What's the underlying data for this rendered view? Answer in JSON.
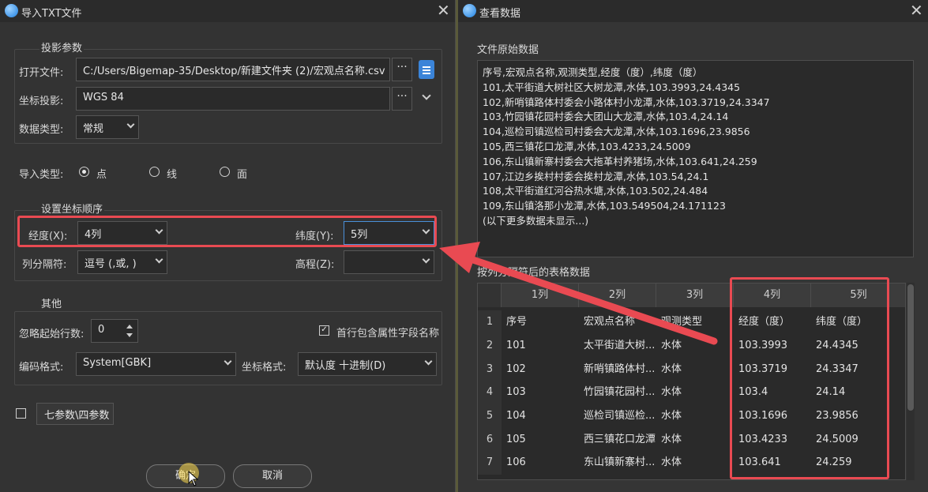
{
  "left": {
    "title": "导入TXT文件",
    "projection": {
      "group_label": "投影参数",
      "open_file_label": "打开文件:",
      "file_path": "C:/Users/Bigemap-35/Desktop/新建文件夹 (2)/宏观点名称.csv",
      "browse": "···",
      "crs_label": "坐标投影:",
      "crs_value": "WGS 84",
      "crs_browse": "···",
      "data_type_label": "数据类型:",
      "data_type_value": "常规"
    },
    "import_type": {
      "label": "导入类型:",
      "options": [
        "点",
        "线",
        "面"
      ],
      "selected": "点"
    },
    "coord_order": {
      "group_label": "设置坐标顺序",
      "lon_label": "经度(X):",
      "lon_value": "4列",
      "lat_label": "纬度(Y):",
      "lat_value": "5列",
      "sep_label": "列分隔符:",
      "sep_value": "逗号 (,或, )",
      "elev_label": "高程(Z):",
      "elev_value": ""
    },
    "other": {
      "group_label": "其他",
      "skip_label": "忽略起始行数:",
      "skip_value": "0",
      "header_check_label": "首行包含属性字段名称",
      "header_checked": true,
      "encoding_label": "编码格式:",
      "encoding_value": "System[GBK]",
      "coord_format_label": "坐标格式:",
      "coord_format_value": "默认度 十进制(D)"
    },
    "seven_params_label": "七参数\\四参数",
    "ok_button": "确定",
    "cancel_button": "取消"
  },
  "right": {
    "title": "查看数据",
    "raw_label": "文件原始数据",
    "raw_lines": [
      "序号,宏观点名称,观测类型,经度（度）,纬度（度）",
      "101,太平街道大树社区大树龙潭,水体,103.3993,24.4345",
      "102,新哨镇路体村委会小路体村小龙潭,水体,103.3719,24.3347",
      "103,竹园镇花园村委会大团山大龙潭,水体,103.4,24.14",
      "104,巡检司镇巡检司村委会大龙潭,水体,103.1696,23.9856",
      "105,西三镇花口龙潭,水体,103.4233,24.5009",
      "106,东山镇新寨村委会大拖革村养猪场,水体,103.641,24.259",
      "107,江边乡挨村村委会挨村龙潭,水体,103.54,24.1",
      "108,太平街道红河谷热水塘,水体,103.502,24.484",
      "109,东山镇洛那小龙潭,水体,103.549504,24.171123",
      "(以下更多数据未显示...)"
    ],
    "table_label": "按列分隔符后的表格数据",
    "table": {
      "headers": [
        "1列",
        "2列",
        "3列",
        "4列",
        "5列"
      ],
      "rows": [
        {
          "num": "1",
          "cells": [
            "序号",
            "宏观点名称",
            "观测类型",
            "经度（度）",
            "纬度（度）"
          ]
        },
        {
          "num": "2",
          "cells": [
            "101",
            "太平街道大树...",
            "水体",
            "103.3993",
            "24.4345"
          ]
        },
        {
          "num": "3",
          "cells": [
            "102",
            "新哨镇路体村...",
            "水体",
            "103.3719",
            "24.3347"
          ]
        },
        {
          "num": "4",
          "cells": [
            "103",
            "竹园镇花园村...",
            "水体",
            "103.4",
            "24.14"
          ]
        },
        {
          "num": "5",
          "cells": [
            "104",
            "巡检司镇巡检...",
            "水体",
            "103.1696",
            "23.9856"
          ]
        },
        {
          "num": "6",
          "cells": [
            "105",
            "西三镇花口龙潭",
            "水体",
            "103.4233",
            "24.5009"
          ]
        },
        {
          "num": "7",
          "cells": [
            "106",
            "东山镇新寨村...",
            "水体",
            "103.641",
            "24.259"
          ]
        }
      ]
    }
  },
  "colors": {
    "highlight_red": "#e94a52",
    "panel_bg": "#333333",
    "field_bg": "#2a2a2a"
  }
}
